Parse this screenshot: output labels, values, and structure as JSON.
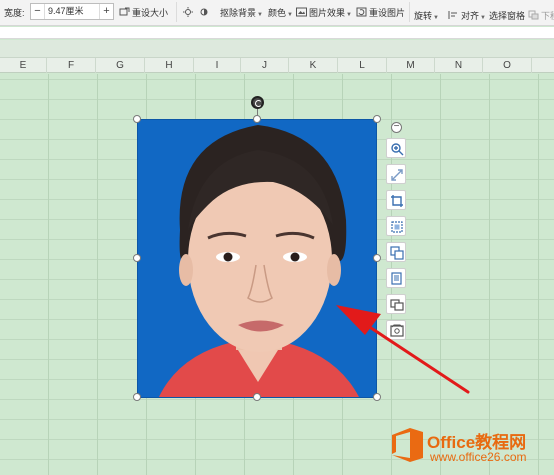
{
  "toolbar": {
    "width_label": "宽度:",
    "width_value": "9.47厘米",
    "minus": "−",
    "plus": "+",
    "reset_size": "重设大小",
    "remove_bg": "抠除背景",
    "color": "颜色",
    "picture_effects": "图片效果",
    "reset_picture": "重设图片",
    "rotate": "旋转",
    "align": "对齐",
    "selection_pane": "选择窗格",
    "next": "下移"
  },
  "columns": [
    "E",
    "F",
    "G",
    "H",
    "I",
    "J",
    "K",
    "L",
    "M",
    "N",
    "O"
  ],
  "side_tools": [
    {
      "name": "zoom-in-icon"
    },
    {
      "name": "crop-magic-icon"
    },
    {
      "name": "crop-icon"
    },
    {
      "name": "fit-icon"
    },
    {
      "name": "copy-picture-icon"
    },
    {
      "name": "duplicate-icon"
    },
    {
      "name": "layers-icon"
    },
    {
      "name": "picture-settings-icon"
    }
  ],
  "watermark": {
    "title": "Office教程网",
    "url": "www.office26.com"
  },
  "colors": {
    "photo_bg": "#1168c4",
    "sheet_bg": "#cfe8d0",
    "arrow": "#e21a1a",
    "brand": "#e86a10"
  }
}
